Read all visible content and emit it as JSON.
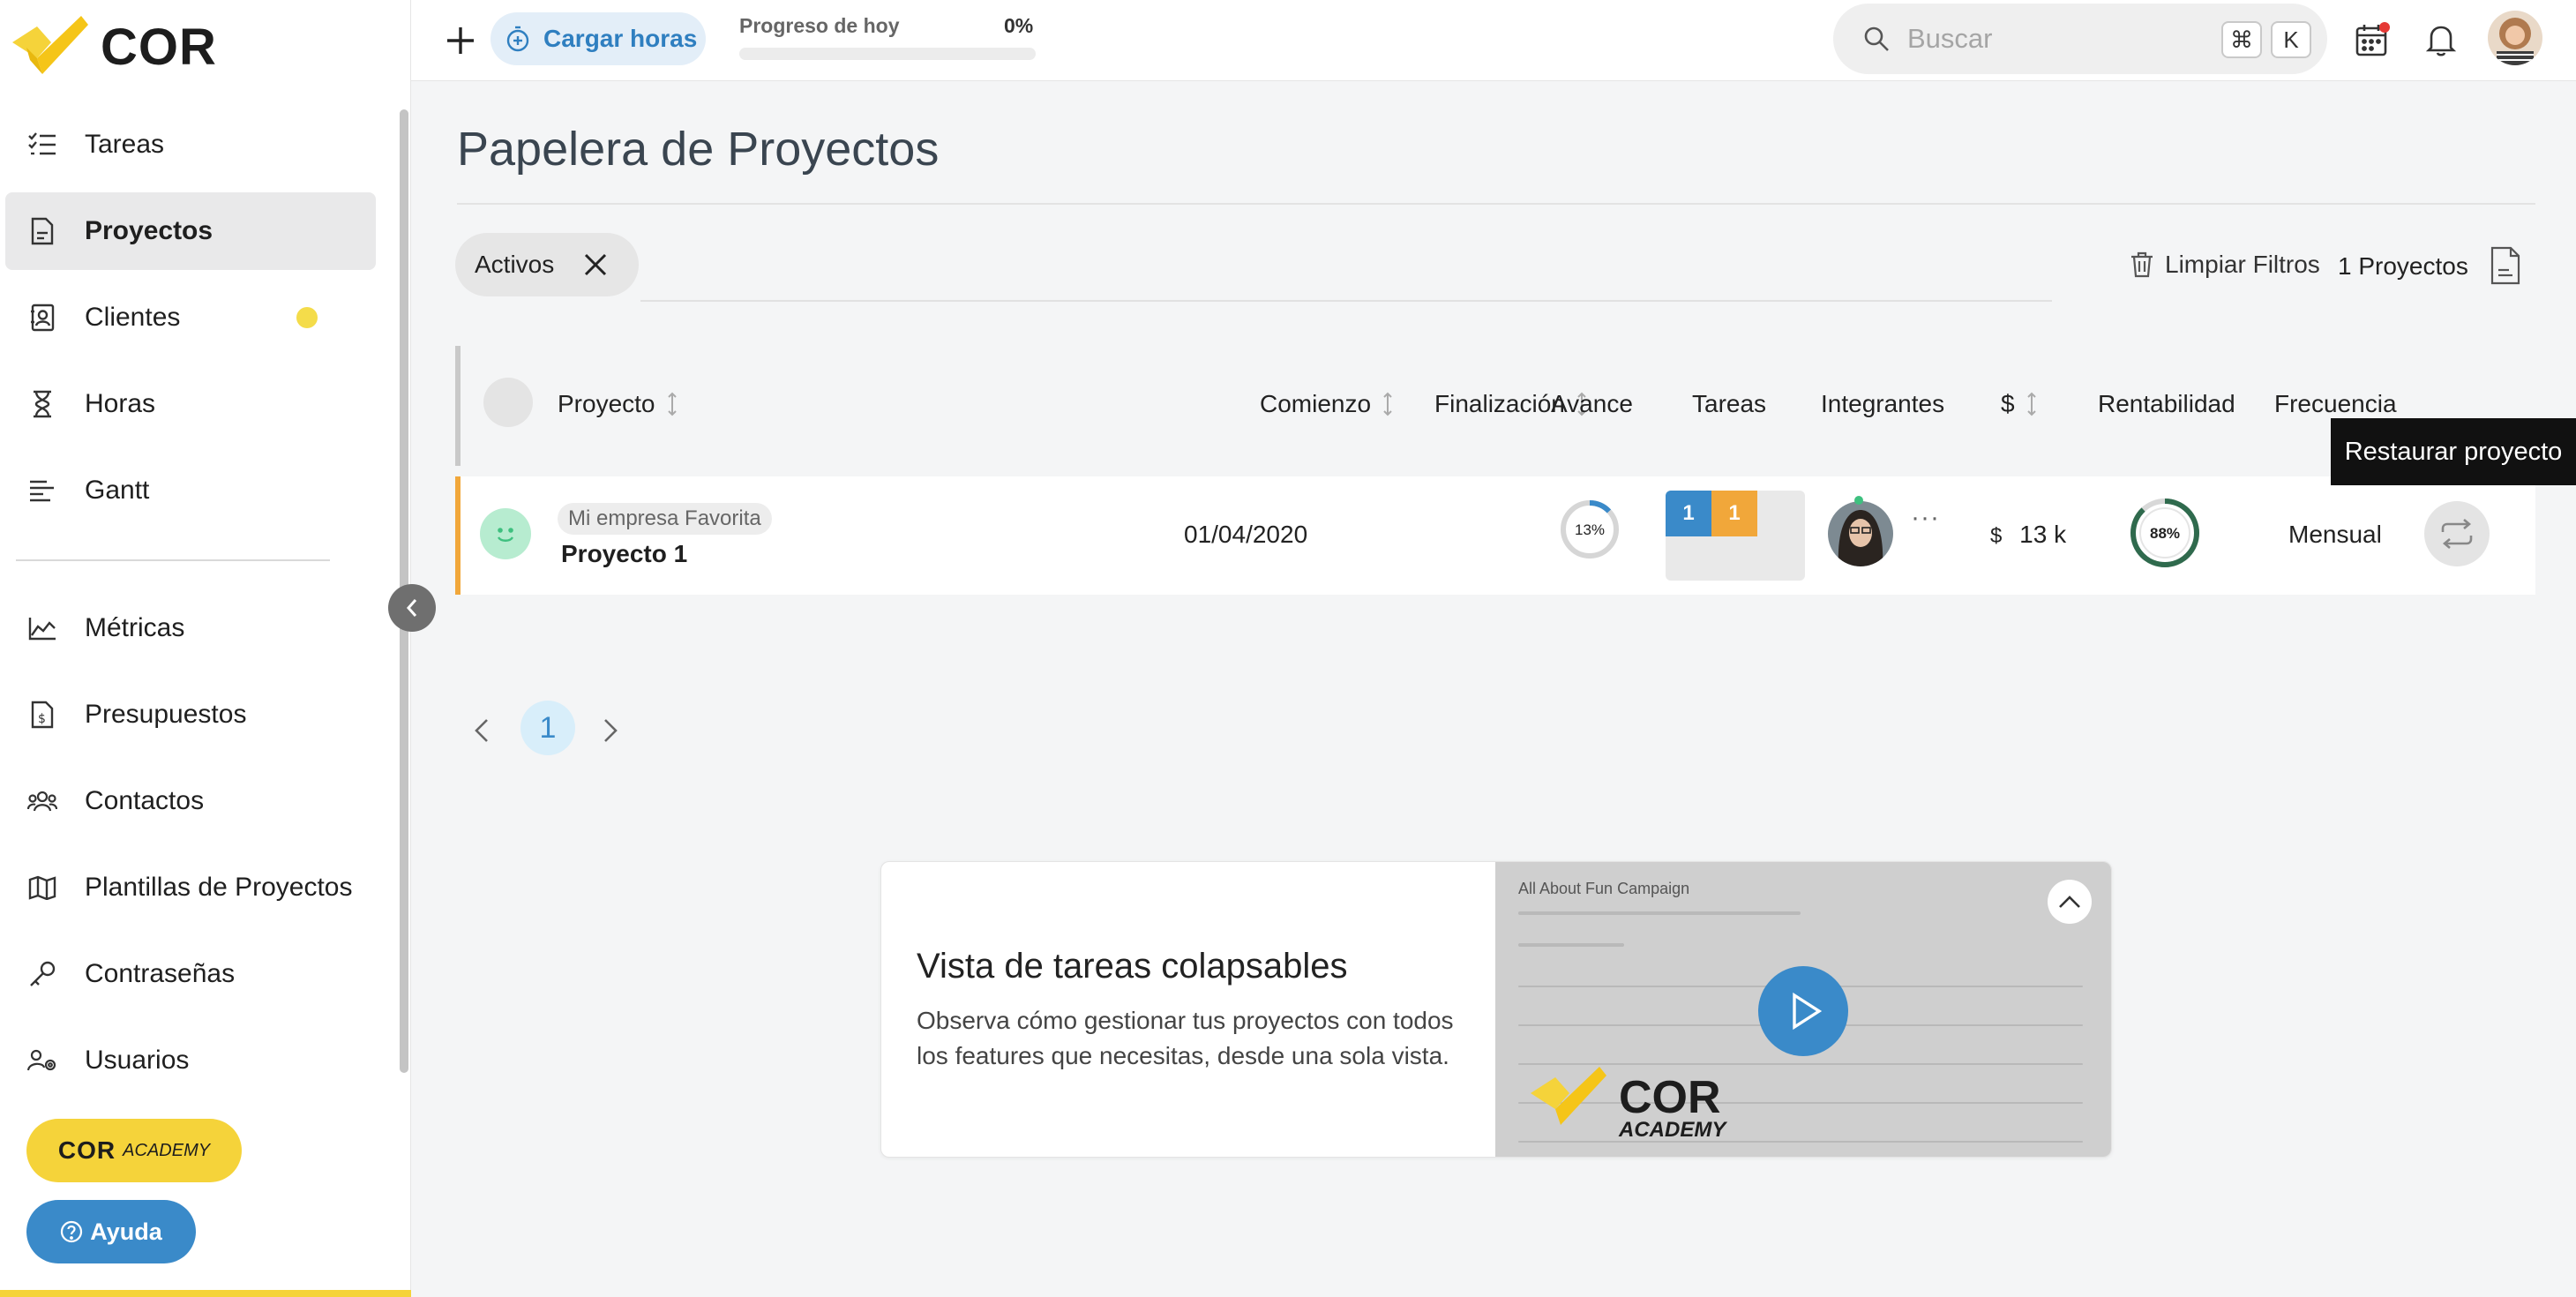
{
  "brand": {
    "name": "COR",
    "accent": "#f5d33a",
    "primary": "#3a8ac9"
  },
  "sidebar": {
    "items": [
      {
        "label": "Tareas",
        "icon": "tasks-list-icon"
      },
      {
        "label": "Proyectos",
        "icon": "document-icon",
        "active": true
      },
      {
        "label": "Clientes",
        "icon": "contact-card-icon",
        "dot": true
      },
      {
        "label": "Horas",
        "icon": "hourglass-icon"
      },
      {
        "label": "Gantt",
        "icon": "gantt-bars-icon"
      }
    ],
    "items2": [
      {
        "label": "Métricas",
        "icon": "area-chart-icon"
      },
      {
        "label": "Presupuestos",
        "icon": "budget-doc-icon"
      },
      {
        "label": "Contactos",
        "icon": "people-icon"
      },
      {
        "label": "Plantillas de Proyectos",
        "icon": "map-icon"
      },
      {
        "label": "Contraseñas",
        "icon": "key-icon"
      },
      {
        "label": "Usuarios",
        "icon": "users-gear-icon"
      }
    ],
    "academy_brand": "COR",
    "academy_word": "ACADEMY",
    "help_label": "Ayuda"
  },
  "topbar": {
    "load_hours_label": "Cargar horas",
    "progress_label": "Progreso de hoy",
    "progress_pct_text": "0%",
    "progress_value": 0,
    "search_placeholder": "Buscar",
    "shortcut_key1": "⌘",
    "shortcut_key2": "K"
  },
  "page": {
    "title": "Papelera de Proyectos",
    "filter_chip": "Activos",
    "clear_filters": "Limpiar Filtros",
    "project_count": "1 Proyectos"
  },
  "table": {
    "columns": {
      "project": "Proyecto",
      "start": "Comienzo",
      "end": "Finalización",
      "progress": "Avance",
      "tasks": "Tareas",
      "members": "Integrantes",
      "money": "$",
      "profitability": "Rentabilidad",
      "frequency": "Frecuencia"
    },
    "rows": [
      {
        "client": "Mi empresa Favorita",
        "name": "Proyecto 1",
        "start": "01/04/2020",
        "end": "",
        "progress_text": "13%",
        "progress_value": 13,
        "tasks_blue": "1",
        "tasks_orange": "1",
        "members_more": "···",
        "currency": "$",
        "amount": "13 k",
        "profitability_text": "88%",
        "profitability_value": 88,
        "frequency": "Mensual"
      }
    ],
    "tooltip": "Restaurar proyecto"
  },
  "pagination": {
    "current": "1"
  },
  "promo": {
    "title": "Vista de tareas colapsables",
    "description": "Observa cómo gestionar tus proyectos con todos los features que necesitas, desde una sola vista.",
    "video_title": "All About Fun Campaign",
    "video_brand": "COR",
    "video_brand_sub": "ACADEMY"
  }
}
